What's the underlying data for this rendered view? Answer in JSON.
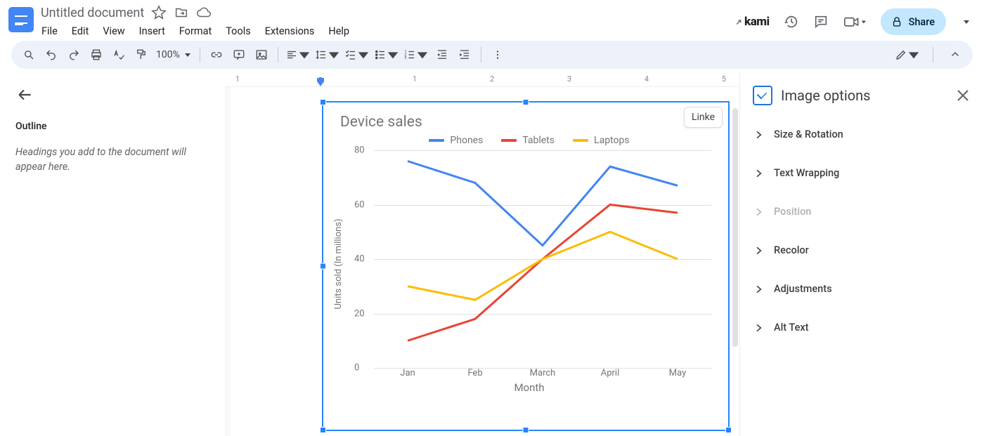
{
  "doc": {
    "title": "Untitled document"
  },
  "menus": [
    "File",
    "Edit",
    "View",
    "Insert",
    "Format",
    "Tools",
    "Extensions",
    "Help"
  ],
  "kami": "kami",
  "share": {
    "label": "Share"
  },
  "zoom": "100%",
  "outline": {
    "title": "Outline",
    "hint": "Headings you add to the document will appear here."
  },
  "ruler": [
    "1",
    "1",
    "2",
    "3",
    "4",
    "5"
  ],
  "image_chip": "Linke",
  "sidebar": {
    "title": "Image options",
    "items": [
      "Size & Rotation",
      "Text Wrapping",
      "Position",
      "Recolor",
      "Adjustments",
      "Alt Text"
    ],
    "disabled_index": 2
  },
  "chart_data": {
    "type": "line",
    "title": "Device sales",
    "xlabel": "Month",
    "ylabel": "Units sold (In millions)",
    "ylim": [
      0,
      80
    ],
    "yticks": [
      0,
      20,
      40,
      60,
      80
    ],
    "categories": [
      "Jan",
      "Feb",
      "March",
      "April",
      "May"
    ],
    "series": [
      {
        "name": "Phones",
        "color": "#4285f4",
        "values": [
          76,
          68,
          45,
          74,
          67
        ]
      },
      {
        "name": "Tablets",
        "color": "#ea4335",
        "values": [
          10,
          18,
          40,
          60,
          57
        ]
      },
      {
        "name": "Laptops",
        "color": "#fbbc04",
        "values": [
          30,
          25,
          40,
          50,
          40
        ]
      }
    ]
  }
}
